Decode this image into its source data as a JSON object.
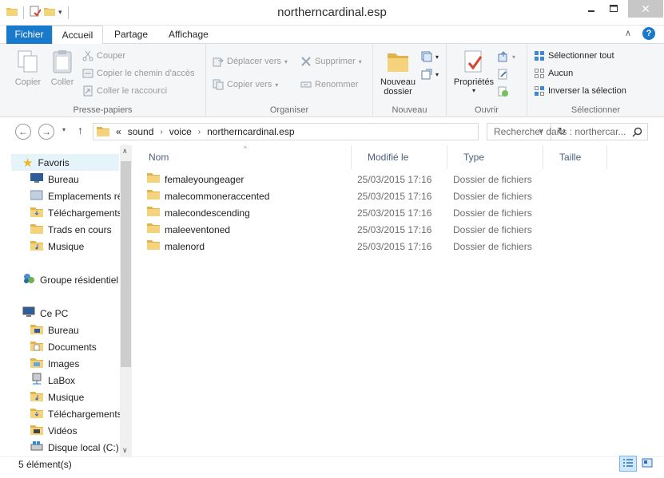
{
  "window": {
    "title": "northerncardinal.esp"
  },
  "tabs": {
    "file": "Fichier",
    "home": "Accueil",
    "share": "Partage",
    "view": "Affichage"
  },
  "ribbon": {
    "clipboard": {
      "label": "Presse-papiers",
      "copy": "Copier",
      "paste": "Coller",
      "cut": "Couper",
      "copy_path": "Copier le chemin d'accès",
      "paste_shortcut": "Coller le raccourci"
    },
    "organize": {
      "label": "Organiser",
      "move_to": "Déplacer vers",
      "copy_to": "Copier vers",
      "delete": "Supprimer",
      "rename": "Renommer"
    },
    "new": {
      "label": "Nouveau",
      "new_folder_line1": "Nouveau",
      "new_folder_line2": "dossier"
    },
    "open": {
      "label": "Ouvrir",
      "properties": "Propriétés"
    },
    "select": {
      "label": "Sélectionner",
      "select_all": "Sélectionner tout",
      "select_none": "Aucun",
      "invert": "Inverser la sélection"
    }
  },
  "address": {
    "overflow": "«",
    "crumbs": [
      "sound",
      "voice",
      "northerncardinal.esp"
    ],
    "search_placeholder": "Rechercher dans : northercar..."
  },
  "nav": {
    "favorites": "Favoris",
    "fav_items": [
      "Bureau",
      "Emplacements ré",
      "Téléchargements",
      "Trads en cours",
      "Musique"
    ],
    "homegroup": "Groupe résidentiel",
    "this_pc": "Ce PC",
    "pc_items": [
      "Bureau",
      "Documents",
      "Images",
      "LaBox",
      "Musique",
      "Téléchargements",
      "Vidéos",
      "Disque local (C:)"
    ]
  },
  "columns": {
    "name": "Nom",
    "modified": "Modifié le",
    "type": "Type",
    "size": "Taille"
  },
  "files": [
    {
      "name": "femaleyoungeager",
      "modified": "25/03/2015 17:16",
      "type": "Dossier de fichiers"
    },
    {
      "name": "malecommoneraccented",
      "modified": "25/03/2015 17:16",
      "type": "Dossier de fichiers"
    },
    {
      "name": "malecondescending",
      "modified": "25/03/2015 17:16",
      "type": "Dossier de fichiers"
    },
    {
      "name": "maleeventoned",
      "modified": "25/03/2015 17:16",
      "type": "Dossier de fichiers"
    },
    {
      "name": "malenord",
      "modified": "25/03/2015 17:16",
      "type": "Dossier de fichiers"
    }
  ],
  "status": {
    "count": "5 élément(s)"
  },
  "colors": {
    "accent": "#1979ca",
    "folder": "#e8c25d",
    "selection": "#e5f3fb"
  }
}
